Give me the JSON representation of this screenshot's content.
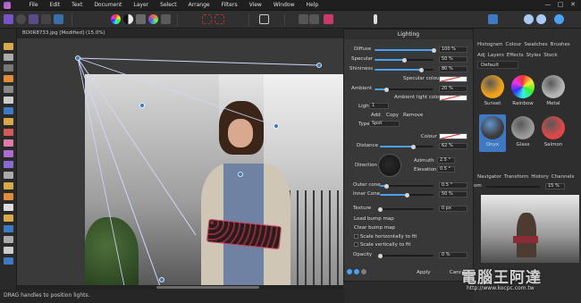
{
  "menu": [
    "File",
    "Edit",
    "Text",
    "Document",
    "Layer",
    "Select",
    "Arrange",
    "Filters",
    "View",
    "Window",
    "Help"
  ],
  "window_controls": [
    "—",
    "□",
    "✕"
  ],
  "document": {
    "tab_title": "BO0R8733.jpg [Modified] (15.0%)"
  },
  "status_bar": {
    "text": "DRAG handles to position lights."
  },
  "lighting": {
    "title": "Lighting",
    "diffuse": {
      "label": "Diffuse",
      "value": "100 %",
      "fraction": 1.0
    },
    "specular": {
      "label": "Specular",
      "value": "50 %",
      "fraction": 0.5
    },
    "shininess": {
      "label": "Shininess",
      "value": "80 %",
      "fraction": 0.8
    },
    "specular_colour_label": "Specular colour",
    "ambient": {
      "label": "Ambient",
      "value": "20 %",
      "fraction": 0.2
    },
    "ambient_light_colour_label": "Ambient light colour",
    "light_label": "Light",
    "light_number": "1",
    "add_label": "Add",
    "copy_label": "Copy",
    "remove_label": "Remove",
    "type_label": "Type",
    "type_value": "Spot",
    "colour_label": "Colour",
    "distance": {
      "label": "Distance",
      "value": "62 %",
      "fraction": 0.62
    },
    "direction_label": "Direction",
    "azimuth": {
      "label": "Azimuth",
      "value": "2.5 °"
    },
    "elevation": {
      "label": "Elevation",
      "value": "0.5 °"
    },
    "outer_cone": {
      "label": "Outer cone",
      "value": "0.5 °",
      "fraction": 0.12
    },
    "inner_cone": {
      "label": "Inner Cone",
      "value": "50 %",
      "fraction": 0.5
    },
    "texture": {
      "label": "Texture",
      "value": "0 px",
      "fraction": 0.0
    },
    "load_bump": "Load bump map",
    "clear_bump": "Clear bump map",
    "scale_h": "Scale horizontally to fit",
    "scale_v": "Scale vertically to fit",
    "opacity": {
      "label": "Opacity",
      "value": "0 %",
      "fraction": 0.0
    },
    "apply_label": "Apply",
    "cancel_label": "Cancel"
  },
  "right_panel": {
    "tabs_row1": [
      "Histogram",
      "Colour",
      "Swatches",
      "Brushes"
    ],
    "tabs_row2": [
      "Adj",
      "Layers",
      "Effects",
      "Styles",
      "Stock"
    ],
    "category": "Default",
    "styles": [
      {
        "name": "Sunset",
        "color": "#f2a31c"
      },
      {
        "name": "Rainbow",
        "color": "#d94ad4"
      },
      {
        "name": "Metal",
        "color": "#b5b5b5"
      },
      {
        "name": "Onyx",
        "color": "#3b3b3b"
      },
      {
        "name": "Glass",
        "color": "#9a9a9a"
      },
      {
        "name": "Salmon",
        "color": "#e04848"
      }
    ],
    "nav_tabs": [
      "Navigator",
      "Transform",
      "History",
      "Channels"
    ],
    "zoom_label": "om",
    "zoom_value": "15 %"
  },
  "watermark": {
    "brand": "電腦王阿達",
    "url": "http://www.kocpc.com.tw"
  },
  "colors": {
    "accent": "#4aa0f2",
    "selection": "#3f79c4",
    "specular_swatch": "#ffffff",
    "light_line": "#cfd6ff"
  }
}
